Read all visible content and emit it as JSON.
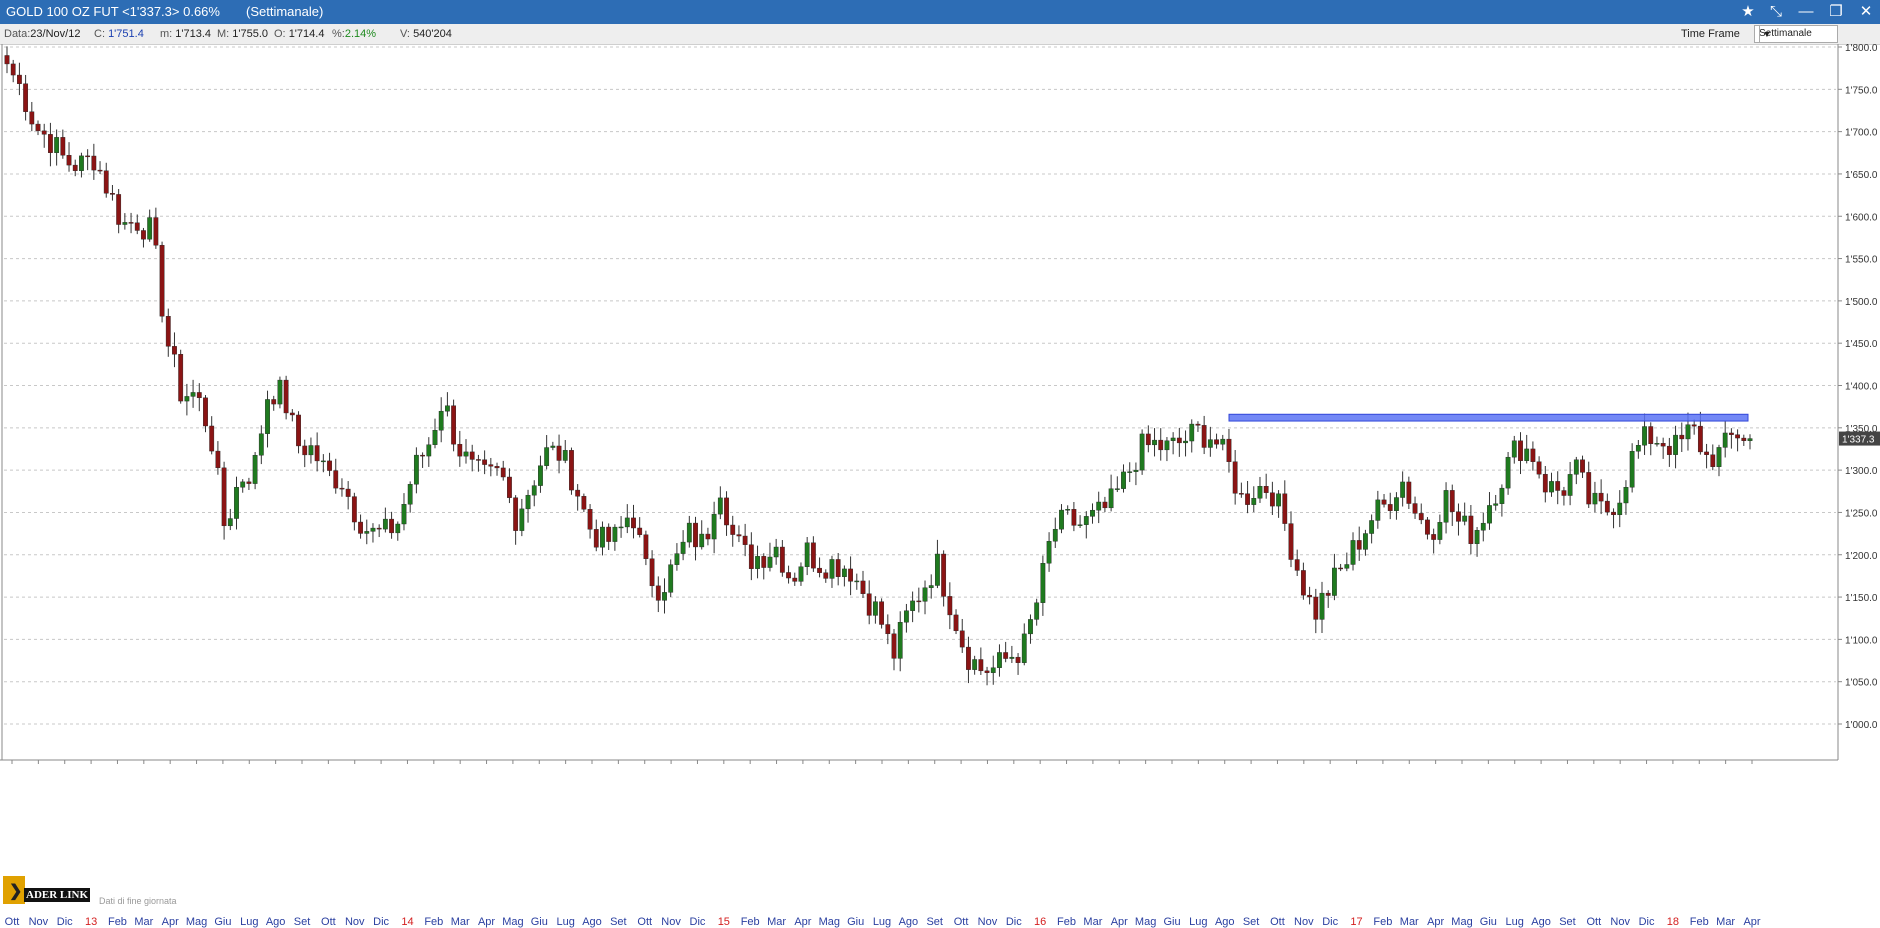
{
  "window": {
    "title": "GOLD 100 OZ FUT <1'337.3> 0.66%",
    "timeframe_paren": "(Settimanale)",
    "icons": [
      "star-icon",
      "pin-icon",
      "minimize-icon",
      "restore-icon",
      "close-icon"
    ]
  },
  "infobar": {
    "date_label": "Data:",
    "date_value": "23/Nov/12",
    "close_label": "C:",
    "close_value": "1'751.4",
    "min_label": "m:",
    "min_value": "1'713.4",
    "max_label": "M:",
    "max_value": "1'755.0",
    "open_label": "O:",
    "open_value": "1'714.4",
    "pct_label": "%:",
    "pct_value": "2.14%",
    "vol_label": "V:",
    "vol_value": "540'204",
    "timeframe_label": "Time Frame",
    "timeframe_value": "Settimanale"
  },
  "branding": {
    "logo_text": "ADER LINK",
    "note": "Dati di fine giornata"
  },
  "colors": {
    "up": "#1f7a1f",
    "down": "#8b1414",
    "resistance": "#5b73f5",
    "titlebar": "#2d6db5",
    "year_label": "#d42020",
    "month_label": "#2a3fa0"
  },
  "chart_data": {
    "type": "candlestick",
    "title": "GOLD 100 OZ FUT",
    "ylim": [
      980,
      1810
    ],
    "yticks": [
      1000,
      1050,
      1100,
      1150,
      1200,
      1250,
      1300,
      1350,
      1400,
      1450,
      1500,
      1550,
      1600,
      1650,
      1700,
      1750,
      1800
    ],
    "ytick_labels": [
      "1'000.0",
      "1'050.0",
      "1'100.0",
      "1'150.0",
      "1'200.0",
      "1'250.0",
      "1'300.0",
      "1'350.0",
      "1'400.0",
      "1'450.0",
      "1'500.0",
      "1'550.0",
      "1'600.0",
      "1'650.0",
      "1'700.0",
      "1'750.0",
      "1'800.0"
    ],
    "grid": true,
    "last_value": 1337.3,
    "last_value_label": "1'337.3",
    "x_labels": [
      "Ott",
      "Nov",
      "Dic",
      "13",
      "Feb",
      "Mar",
      "Apr",
      "Mag",
      "Giu",
      "Lug",
      "Ago",
      "Set",
      "Ott",
      "Nov",
      "Dic",
      "14",
      "Feb",
      "Mar",
      "Apr",
      "Mag",
      "Giu",
      "Lug",
      "Ago",
      "Set",
      "Ott",
      "Nov",
      "Dic",
      "15",
      "Feb",
      "Mar",
      "Apr",
      "Mag",
      "Giu",
      "Lug",
      "Ago",
      "Set",
      "Ott",
      "Nov",
      "Dic",
      "16",
      "Feb",
      "Mar",
      "Apr",
      "Mag",
      "Giu",
      "Lug",
      "Ago",
      "Set",
      "Ott",
      "Nov",
      "Dic",
      "17",
      "Feb",
      "Mar",
      "Apr",
      "Mag",
      "Giu",
      "Lug",
      "Ago",
      "Set",
      "Ott",
      "Nov",
      "Dic",
      "18",
      "Feb",
      "Mar",
      "Apr"
    ],
    "year_labels": [
      "13",
      "14",
      "15",
      "16",
      "17",
      "18"
    ],
    "close_anchors": [
      [
        1780,
        1750,
        1705,
        1690,
        1665,
        1660,
        1670,
        1630,
        1590,
        1595,
        1580
      ],
      [
        1455,
        1390,
        1390,
        1345,
        1230,
        1290,
        1300,
        1395,
        1390,
        1330,
        1325
      ],
      [
        1295,
        1290,
        1250,
        1225,
        1225,
        1240,
        1300,
        1330,
        1385,
        1330,
        1300
      ],
      [
        1290,
        1295,
        1245,
        1280,
        1320,
        1320,
        1290,
        1235,
        1215,
        1220,
        1255
      ],
      [
        1180,
        1160,
        1190,
        1225,
        1210,
        1290,
        1220,
        1195,
        1200,
        1210,
        1170
      ],
      [
        1205,
        1190,
        1190,
        1185,
        1155,
        1130,
        1080,
        1130,
        1160,
        1190,
        1140
      ],
      [
        1085,
        1065,
        1065,
        1080,
        1090,
        1150,
        1230,
        1240,
        1235,
        1245,
        1260
      ],
      [
        1290,
        1325,
        1330,
        1325,
        1335,
        1345,
        1340,
        1310,
        1265,
        1280,
        1280
      ],
      [
        1235,
        1175,
        1130,
        1160,
        1185,
        1215,
        1245,
        1260,
        1290,
        1250,
        1225
      ],
      [
        1270,
        1235,
        1225,
        1260,
        1295,
        1330,
        1320,
        1280,
        1275,
        1300,
        1260
      ],
      [
        1250,
        1270,
        1320,
        1340,
        1335,
        1325,
        1350,
        1315,
        1320,
        1345,
        1337.3
      ]
    ],
    "resistance": {
      "level": 1362,
      "start": "2016-09",
      "end": "2018-04",
      "color": "#5b73f5"
    }
  }
}
